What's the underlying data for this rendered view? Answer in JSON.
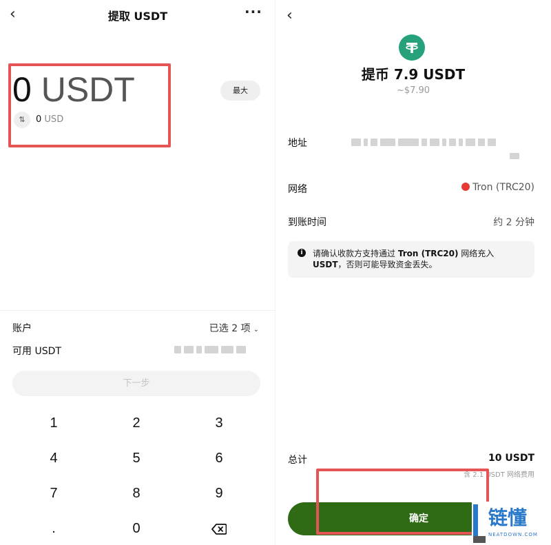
{
  "withdraw_screen": {
    "back_icon": "chevron-left-icon",
    "title": "提取 USDT",
    "more_icon": "more-dots-icon",
    "amount_number": "0",
    "amount_unit": "USDT",
    "max_label": "最大",
    "swap_icon": "swap-arrows-icon",
    "usd_number": "0",
    "usd_unit": "USD",
    "account_label": "账户",
    "account_value": "已选 2 项",
    "available_label": "可用 USDT",
    "next_label": "下一步",
    "keypad": [
      "1",
      "2",
      "3",
      "4",
      "5",
      "6",
      "7",
      "8",
      "9",
      ".",
      "0"
    ],
    "backspace_icon": "backspace-icon"
  },
  "confirm_screen": {
    "back_icon": "chevron-left-icon",
    "coin_icon": "tether-icon",
    "title": "提币 7.9 USDT",
    "subtitle": "~$7.90",
    "address_label": "地址",
    "network_label": "网络",
    "network_value": "Tron (TRC20)",
    "arrival_label": "到账时间",
    "arrival_value": "约 2 分钟",
    "notice_pre": "请确认收款方支持通过 ",
    "notice_network": "Tron (TRC20)",
    "notice_mid": " 网络充入 ",
    "notice_token": "USDT",
    "notice_post": "，否则可能导致资金丢失。",
    "total_label": "总计",
    "total_value": "10 USDT",
    "fee_note": "含 2.1 USDT 网络费用",
    "confirm_label": "确定"
  },
  "watermark": {
    "text": "链懂",
    "sub": "NEATDOWN.COM"
  },
  "colors": {
    "accent_green": "#2e6b14",
    "tether_green": "#26a17b",
    "tron_red": "#e53935",
    "highlight_red": "#e65555",
    "watermark_blue": "#2a78c9"
  }
}
